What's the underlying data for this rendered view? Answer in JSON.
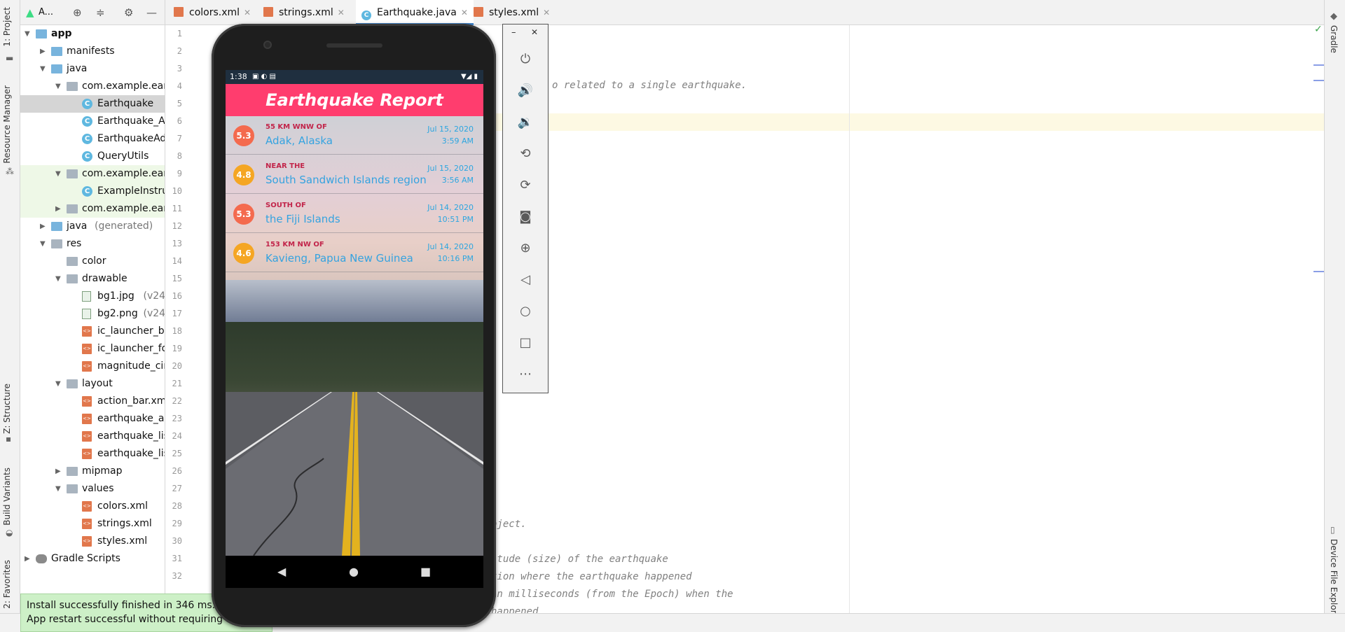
{
  "left_strip": {
    "project_label": "1: Project",
    "resource_manager_label": "Resource Manager",
    "structure_label": "Z: Structure",
    "build_variants_label": "Build Variants",
    "favorites_label": "2: Favorites"
  },
  "project_toolbar": {
    "dropdown_label": "A..."
  },
  "tree": [
    {
      "label": "app",
      "arrow": "▼"
    },
    {
      "label": "manifests",
      "arrow": "▶"
    },
    {
      "label": "java",
      "arrow": "▼"
    },
    {
      "label": "com.example.ear",
      "arrow": "▼"
    },
    {
      "label": "Earthquake",
      "arrow": ""
    },
    {
      "label": "Earthquake_A",
      "arrow": ""
    },
    {
      "label": "EarthquakeAd",
      "arrow": ""
    },
    {
      "label": "QueryUtils",
      "arrow": ""
    },
    {
      "label": "com.example.ear",
      "arrow": "▼"
    },
    {
      "label": "ExampleInstru",
      "arrow": ""
    },
    {
      "label": "com.example.ear",
      "arrow": "▶"
    },
    {
      "label": "java",
      "suffix": "(generated)",
      "arrow": "▶"
    },
    {
      "label": "res",
      "arrow": "▼"
    },
    {
      "label": "color",
      "arrow": ""
    },
    {
      "label": "drawable",
      "arrow": "▼"
    },
    {
      "label": "bg1.jpg",
      "suffix": "(v24)",
      "arrow": ""
    },
    {
      "label": "bg2.png",
      "suffix": "(v24)",
      "arrow": ""
    },
    {
      "label": "ic_launcher_ba",
      "arrow": ""
    },
    {
      "label": "ic_launcher_fo",
      "arrow": ""
    },
    {
      "label": "magnitude_cir",
      "arrow": ""
    },
    {
      "label": "layout",
      "arrow": "▼"
    },
    {
      "label": "action_bar.xm",
      "arrow": ""
    },
    {
      "label": "earthquake_ac",
      "arrow": ""
    },
    {
      "label": "earthquake_lis",
      "arrow": ""
    },
    {
      "label": "earthquake_lis",
      "arrow": ""
    },
    {
      "label": "mipmap",
      "arrow": "▶"
    },
    {
      "label": "values",
      "arrow": "▼"
    },
    {
      "label": "colors.xml",
      "arrow": ""
    },
    {
      "label": "strings.xml",
      "arrow": ""
    },
    {
      "label": "styles.xml",
      "arrow": ""
    },
    {
      "label": "Gradle Scripts",
      "arrow": "▶"
    }
  ],
  "tabs": [
    {
      "label": "colors.xml"
    },
    {
      "label": "strings.xml"
    },
    {
      "label": "Earthquake.java"
    },
    {
      "label": "styles.xml"
    }
  ],
  "gutter": {
    "lines": [
      "1",
      "2",
      "3",
      "4",
      "5",
      "6",
      "7",
      "8",
      "9",
      "10",
      "11",
      "12",
      "13",
      "14",
      "15",
      "16",
      "17",
      "18",
      "19",
      "20",
      "21",
      "22",
      "23",
      "24",
      "25",
      "26",
      "27",
      "28",
      "29",
      "30",
      "31",
      "32"
    ]
  },
  "code": {
    "line4": "o related to a single earthquake.",
    "line29": "bject.",
    "line31": "itude (size) of the earthquake",
    "line32": "tion where the earthquake happened",
    "line33": "in milliseconds (from the Epoch) when the",
    "line34": "happened"
  },
  "right_strip": {
    "gradle_label": "Gradle",
    "device_file_explorer_label": "Device File Explorer"
  },
  "toast": {
    "line1": "Install successfully finished in 346 ms.",
    "line2": "App restart successful without requiring a re"
  },
  "phone": {
    "status_time": "1:38",
    "app_title": "Earthquake Report",
    "earthquakes": [
      {
        "mag": "5.3",
        "offset": "55 KM WNW OF",
        "place": "Adak, Alaska",
        "date": "Jul 15, 2020",
        "time": "3:59 AM",
        "color": "#f46a4e"
      },
      {
        "mag": "4.8",
        "offset": "NEAR THE",
        "place": "South Sandwich Islands region",
        "date": "Jul 15, 2020",
        "time": "3:56 AM",
        "color": "#f5a623"
      },
      {
        "mag": "5.3",
        "offset": "SOUTH OF",
        "place": "the Fiji Islands",
        "date": "Jul 14, 2020",
        "time": "10:51 PM",
        "color": "#f46a4e"
      },
      {
        "mag": "4.6",
        "offset": "153 KM NW OF",
        "place": "Kavieng, Papua New Guinea",
        "date": "Jul 14, 2020",
        "time": "10:16 PM",
        "color": "#f5a623"
      }
    ]
  },
  "emulator_toolbar": {
    "minimize": "–",
    "close": "✕"
  },
  "colors": {
    "app_bar": "#ff3d6e",
    "accent_blue": "#35a3e0",
    "toast_bg": "#cdf0c7"
  }
}
